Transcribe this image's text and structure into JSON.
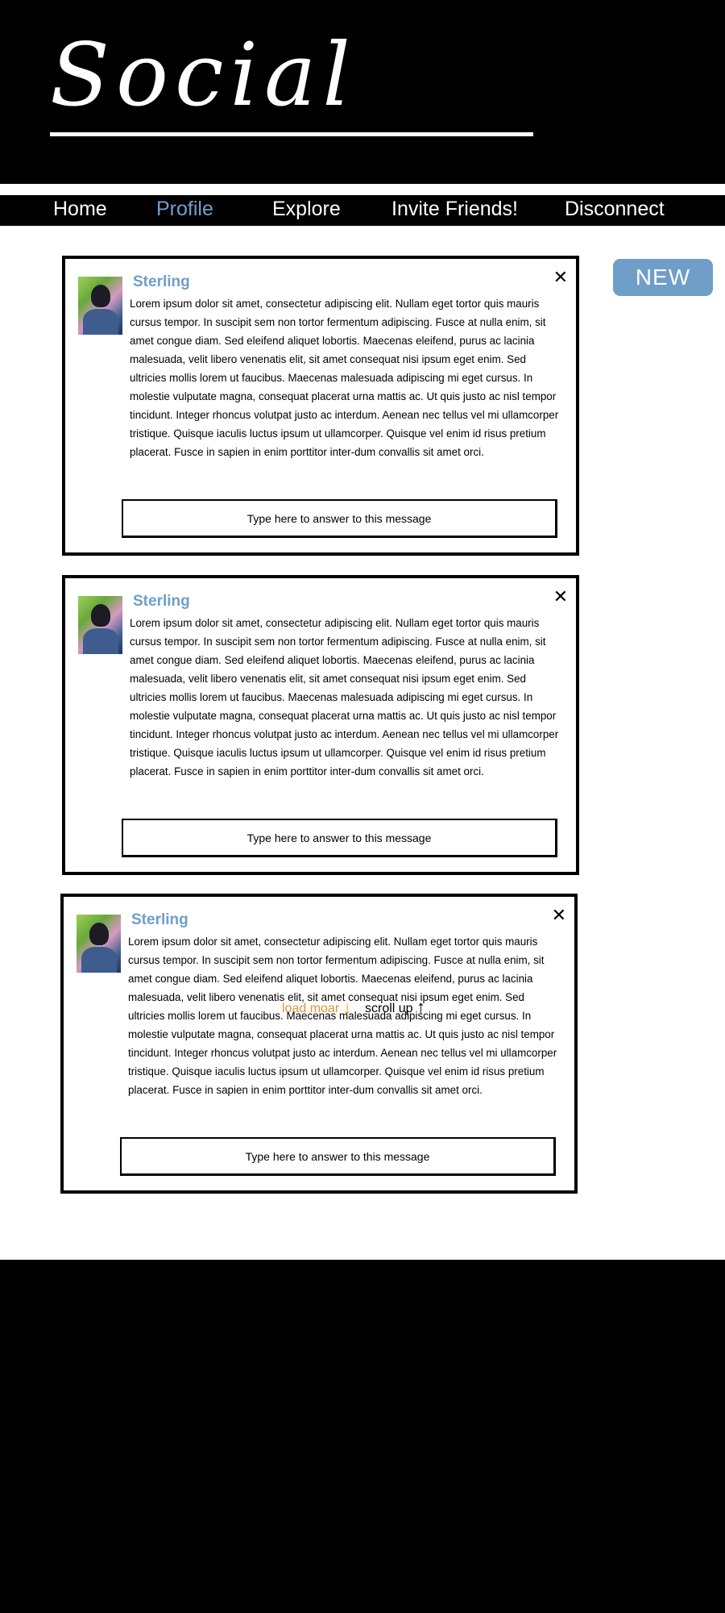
{
  "header": {
    "logo_text": "Social"
  },
  "nav": {
    "items": [
      {
        "label": "Home"
      },
      {
        "label": "Profile",
        "active": true
      },
      {
        "label": "Explore"
      },
      {
        "label": "Invite Friends!"
      },
      {
        "label": "Disconnect"
      }
    ]
  },
  "new_button_label": "NEW",
  "posts": [
    {
      "author": "Sterling",
      "close_symbol": "✕",
      "text": "Lorem ipsum dolor sit amet, consectetur adipiscing elit. Nullam eget tortor quis mauris cursus tempor. In suscipit sem non tortor fermentum adipiscing. Fusce at nulla enim, sit amet congue diam. Sed eleifend aliquet lobortis. Maecenas eleifend, purus ac lacinia malesuada, velit libero venenatis elit, sit amet consequat nisi ipsum eget enim. Sed ultricies mollis lorem ut faucibus. Maecenas malesuada adipiscing mi eget cursus. In molestie vulputate magna, consequat placerat urna mattis ac. Ut quis justo ac nisl tempor tincidunt. Integer rhoncus volutpat justo ac interdum. Aenean nec tellus vel mi ullamcorper tristique. Quisque iaculis luctus ipsum ut ullamcorper. Quisque vel enim id risus pretium placerat. Fusce in sapien in enim porttitor inter-dum convallis sit amet orci.",
      "reply_placeholder": "Type here to answer to this message"
    },
    {
      "author": "Sterling",
      "close_symbol": "✕",
      "text": "Lorem ipsum dolor sit amet, consectetur adipiscing elit. Nullam eget tortor quis mauris cursus tempor. In suscipit sem non tortor fermentum adipiscing. Fusce at nulla enim, sit amet congue diam. Sed eleifend aliquet lobortis. Maecenas eleifend, purus ac lacinia malesuada, velit libero venenatis elit, sit amet consequat nisi ipsum eget enim. Sed ultricies mollis lorem ut faucibus. Maecenas malesuada adipiscing mi eget cursus. In molestie vulputate magna, consequat placerat urna mattis ac. Ut quis justo ac nisl tempor tincidunt. Integer rhoncus volutpat justo ac interdum. Aenean nec tellus vel mi ullamcorper tristique. Quisque iaculis luctus ipsum ut ullamcorper. Quisque vel enim id risus pretium placerat. Fusce in sapien in enim porttitor inter-dum convallis sit amet orci.",
      "reply_placeholder": "Type here to answer to this message"
    },
    {
      "author": "Sterling",
      "close_symbol": "✕",
      "text": "Lorem ipsum dolor sit amet, consectetur adipiscing elit. Nullam eget tortor quis mauris cursus tempor. In suscipit sem non tortor fermentum adipiscing. Fusce at nulla enim, sit amet congue diam. Sed eleifend aliquet lobortis. Maecenas eleifend, purus ac lacinia malesuada, velit libero venenatis elit, sit amet consequat nisi ipsum eget enim. Sed ultricies mollis lorem ut faucibus. Maecenas malesuada adipiscing mi eget cursus. In molestie vulputate magna, consequat placerat urna mattis ac. Ut quis justo ac nisl tempor tincidunt. Integer rhoncus volutpat justo ac interdum. Aenean nec tellus vel mi ullamcorper tristique. Quisque iaculis luctus ipsum ut ullamcorper. Quisque vel enim id risus pretium placerat. Fusce in sapien in enim porttitor inter-dum convallis sit amet orci.",
      "reply_placeholder": "Type here to answer to this message"
    }
  ],
  "footer": {
    "load_more_label": "load moar",
    "load_more_arrow": "↓",
    "scroll_up_label": "scroll up",
    "scroll_up_arrow": "↑"
  },
  "colors": {
    "accent_blue": "#6f9ec8",
    "load_more_orange": "#d4993a",
    "background_dark": "#000000"
  }
}
